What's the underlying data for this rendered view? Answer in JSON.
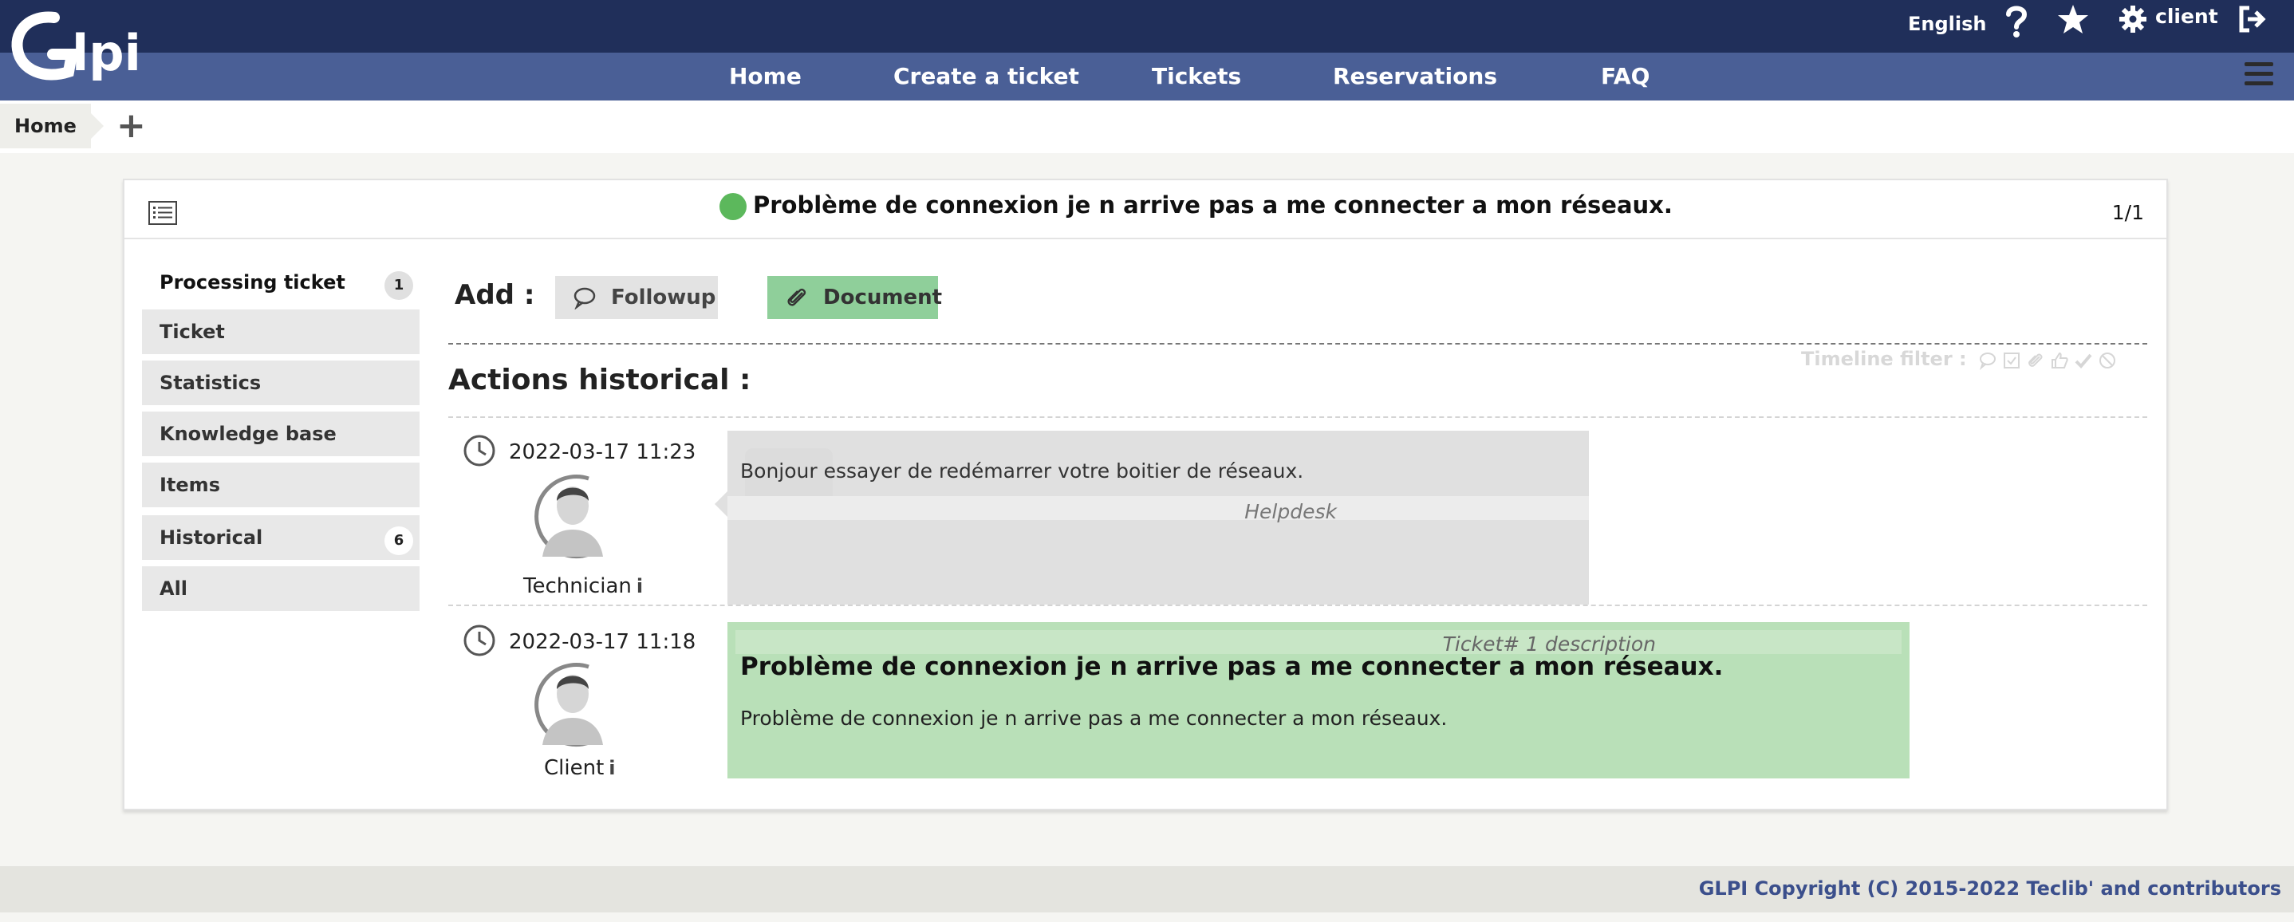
{
  "header": {
    "logo_text": "Glpi",
    "language": "English",
    "user": "client",
    "icons": [
      "help-icon",
      "star-icon",
      "gear-icon",
      "logout-icon"
    ]
  },
  "nav": {
    "items": [
      {
        "label": "Home"
      },
      {
        "label": "Create a ticket"
      },
      {
        "label": "Tickets"
      },
      {
        "label": "Reservations"
      },
      {
        "label": "FAQ"
      }
    ]
  },
  "breadcrumb": {
    "home": "Home",
    "add": "+"
  },
  "ticket": {
    "title": "Problème de connexion je n arrive pas a me connecter a mon réseaux.",
    "status_color": "#5cb85c",
    "pager": "1/1"
  },
  "sidebar": {
    "items": [
      {
        "label": "Processing ticket",
        "badge": "1"
      },
      {
        "label": "Ticket"
      },
      {
        "label": "Statistics"
      },
      {
        "label": "Knowledge base"
      },
      {
        "label": "Items"
      },
      {
        "label": "Historical",
        "badge": "6"
      },
      {
        "label": "All"
      }
    ]
  },
  "actions": {
    "add_label": "Add :",
    "followup": "Followup",
    "document": "Document",
    "timeline_filter": "Timeline filter :",
    "history_title": "Actions historical :"
  },
  "timeline": [
    {
      "date": "2022-03-17 11:23",
      "role": "Technician",
      "content": "Bonjour essayer de redémarrer votre boitier de réseaux.",
      "signature": "Helpdesk"
    },
    {
      "date": "2022-03-17 11:18",
      "role": "Client",
      "meta": "Ticket# 1 description",
      "title": "Problème de connexion je n arrive pas a me connecter a mon réseaux.",
      "content": "Problème de connexion je n arrive pas a me connecter a mon réseaux."
    }
  ],
  "footer": {
    "copyright": "GLPI Copyright (C) 2015-2022 Teclib' and contributors"
  }
}
